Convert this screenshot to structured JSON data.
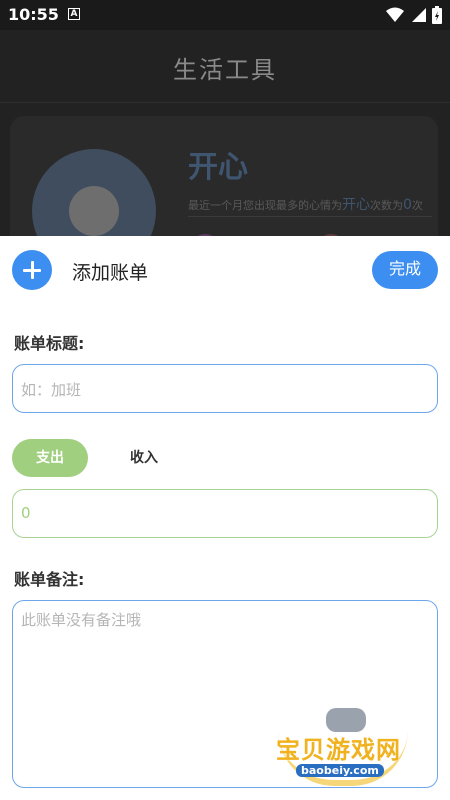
{
  "status_bar": {
    "time": "10:55",
    "notification_badge": "A"
  },
  "background_page": {
    "title": "生活工具",
    "mood": "开心",
    "desc_prefix": "最近一个月您出现最多的心情为",
    "desc_mood": "开心",
    "desc_mid": "次数为",
    "desc_count": "0",
    "desc_suffix": "次"
  },
  "sheet": {
    "add_icon": "plus-icon",
    "title": "添加账单",
    "done_label": "完成",
    "title_label": "账单标题:",
    "title_placeholder": "如：加班",
    "type_expense": "支出",
    "type_income": "收入",
    "amount_value": "0",
    "note_label": "账单备注:",
    "note_placeholder": "此账单没有备注哦"
  },
  "watermark": {
    "text": "宝贝游戏网",
    "url": "baobeiy.com"
  },
  "colors": {
    "accent": "#3c8ef0",
    "expense": "#9fcf7f",
    "input_border": "#6ea6ec"
  }
}
